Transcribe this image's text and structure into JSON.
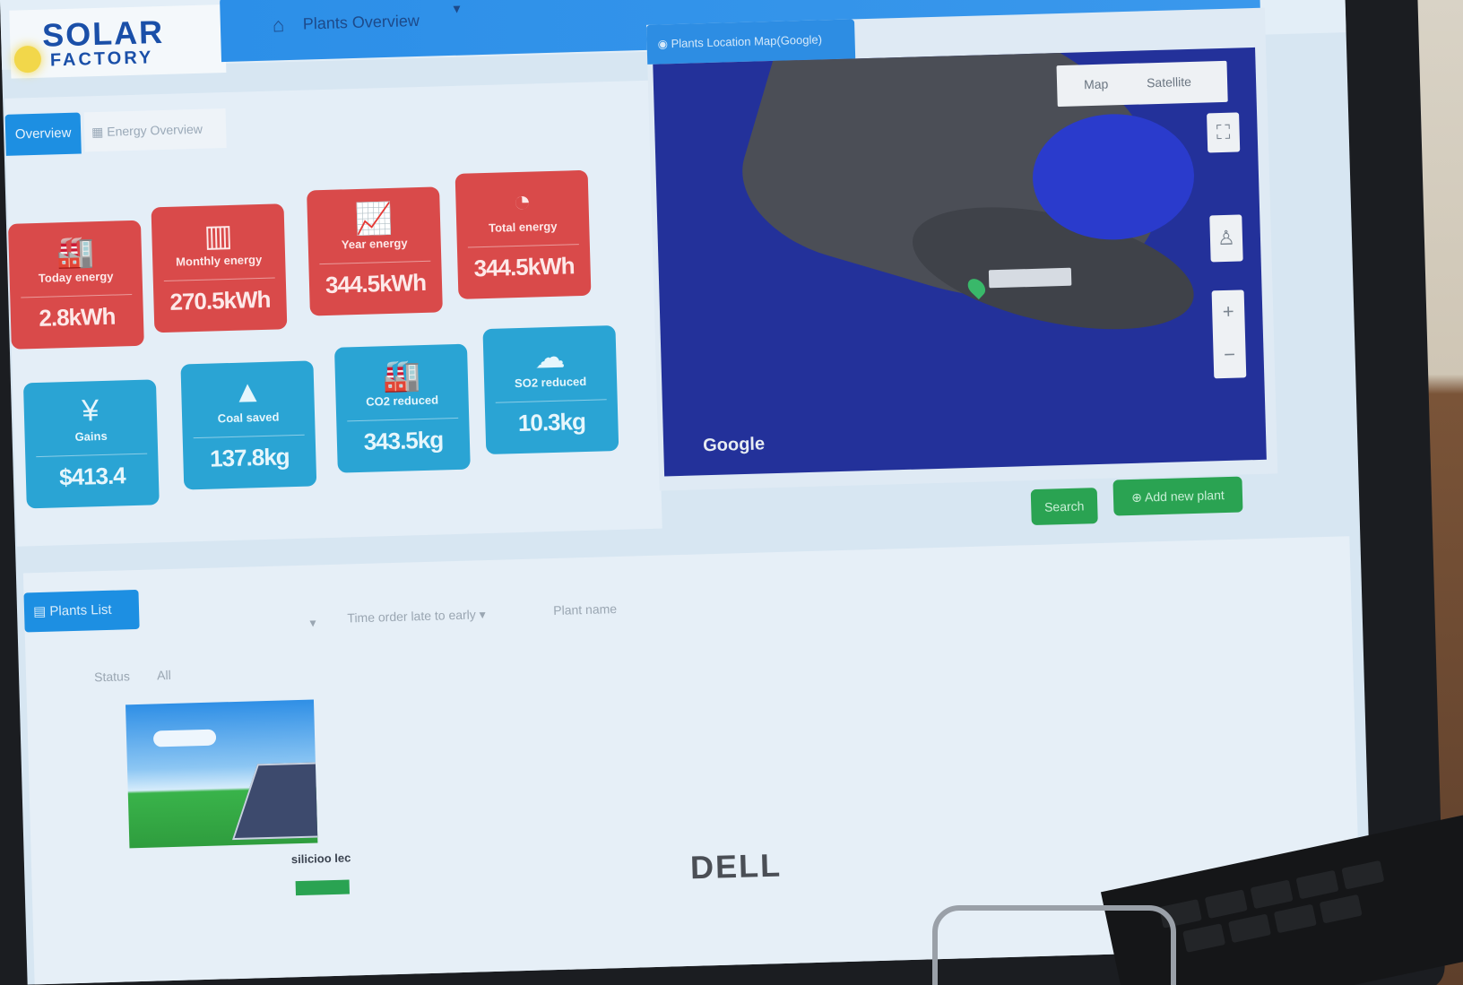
{
  "brand": {
    "line1": "SOLAR",
    "line2": "FACTORY"
  },
  "nav": {
    "tab_label": "Plants Overview"
  },
  "overview": {
    "tabs": [
      {
        "label": "Overview"
      },
      {
        "label": "Energy Overview"
      }
    ],
    "tiles_red": [
      {
        "label": "Today energy",
        "value": "2.8kWh",
        "icon": "factory-icon"
      },
      {
        "label": "Monthly energy",
        "value": "270.5kWh",
        "icon": "bar-chart-icon"
      },
      {
        "label": "Year energy",
        "value": "344.5kWh",
        "icon": "line-chart-icon"
      },
      {
        "label": "Total energy",
        "value": "344.5kWh",
        "icon": "pie-chart-icon"
      }
    ],
    "tiles_blue": [
      {
        "label": "Gains",
        "value": "$413.4",
        "icon": "yen-icon"
      },
      {
        "label": "Coal saved",
        "value": "137.8kg",
        "icon": "coal-pile-icon"
      },
      {
        "label": "CO2 reduced",
        "value": "343.5kg",
        "icon": "co2-factory-icon"
      },
      {
        "label": "SO2 reduced",
        "value": "10.3kg",
        "icon": "cloud-icon"
      }
    ]
  },
  "map": {
    "title": "Plants Location Map(Google)",
    "map_type": {
      "map": "Map",
      "satellite": "Satellite"
    },
    "attribution": "Google",
    "actions": {
      "search": "Search",
      "add_plant": "Add new plant"
    }
  },
  "plants": {
    "title": "Plants List",
    "sort": "Time order late to early",
    "plant_name_placeholder": "Plant name",
    "status_label": "Status",
    "status_value": "All",
    "items": [
      {
        "name": "silicioo lec"
      }
    ]
  },
  "device": {
    "brand": "DELL"
  }
}
